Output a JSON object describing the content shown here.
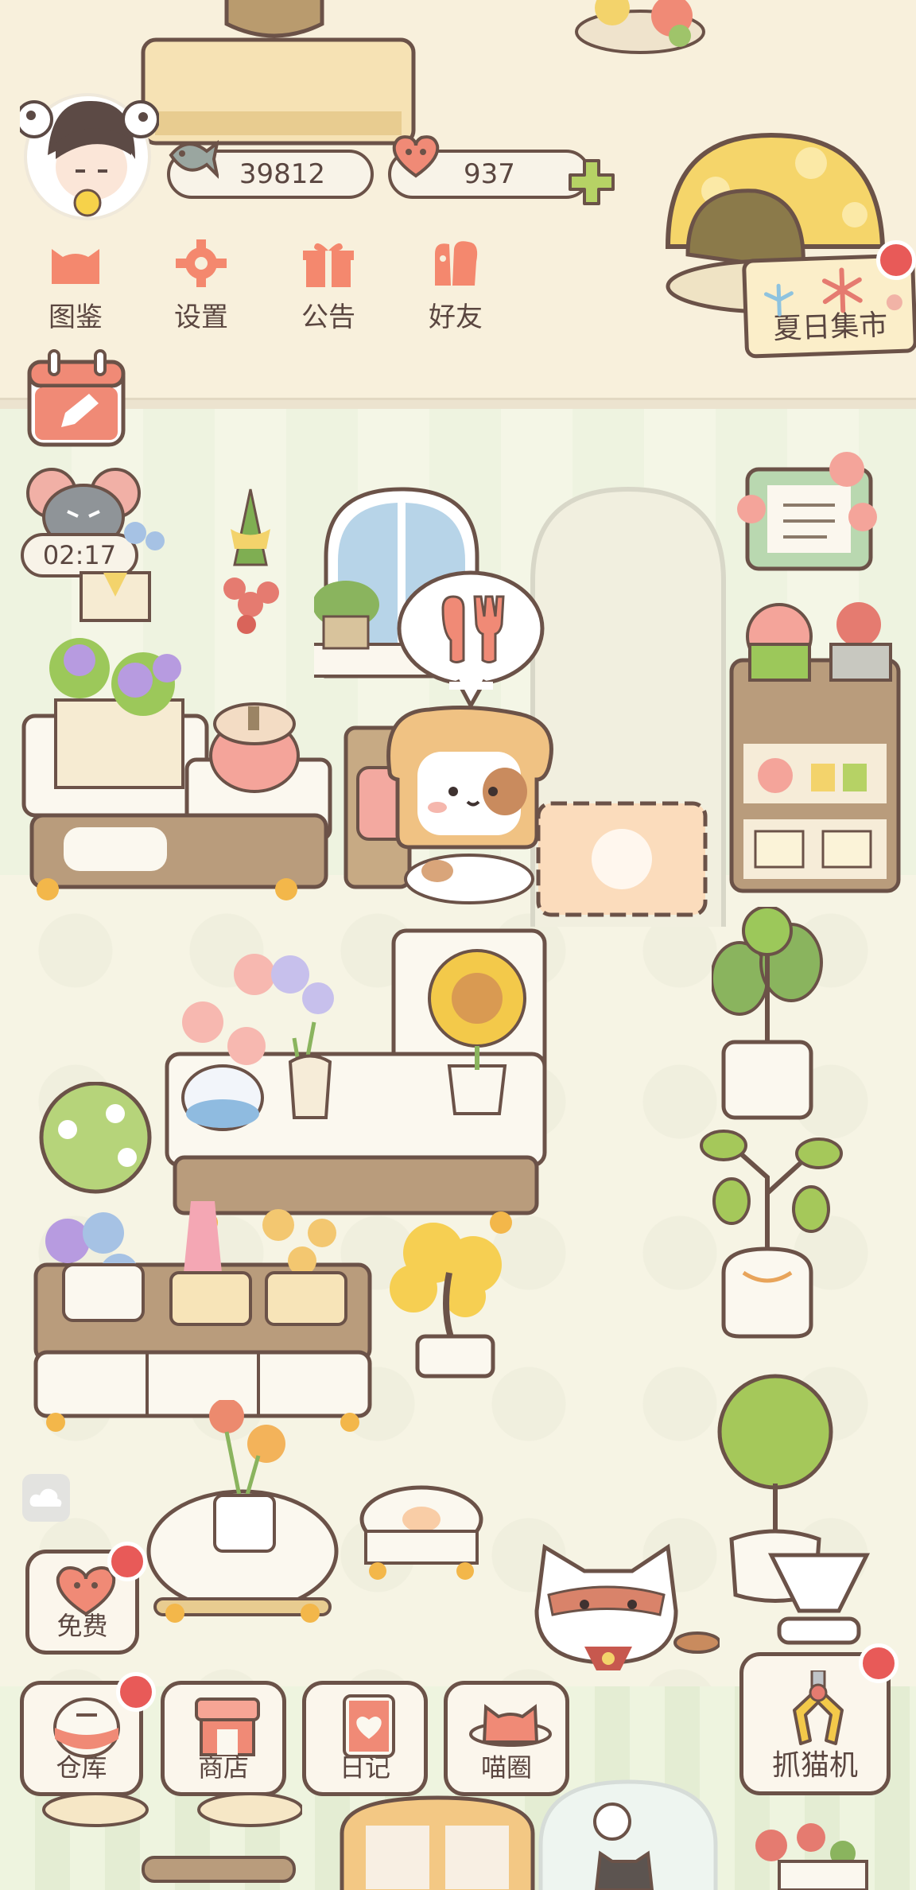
{
  "hud": {
    "fish_count": "39812",
    "heart_count": "937",
    "plus_icon": "plus-icon"
  },
  "menu": [
    {
      "label": "图鉴",
      "icon": "cat-head-icon"
    },
    {
      "label": "设置",
      "icon": "gear-icon"
    },
    {
      "label": "公告",
      "icon": "gift-icon"
    },
    {
      "label": "好友",
      "icon": "friends-icon"
    }
  ],
  "event": {
    "label": "夏日集市"
  },
  "timer": {
    "value": "02:17"
  },
  "free": {
    "label": "免费"
  },
  "bottom_nav": [
    {
      "label": "仓库",
      "icon": "warehouse-icon"
    },
    {
      "label": "商店",
      "icon": "shop-icon"
    },
    {
      "label": "日记",
      "icon": "diary-icon"
    },
    {
      "label": "喵圈",
      "icon": "cat-planet-icon"
    }
  ],
  "claw": {
    "label": "抓猫机"
  },
  "colors": {
    "outline": "#6b5248",
    "accent_red": "#e85a58",
    "coral": "#f08a76",
    "green": "#a5c85a"
  }
}
